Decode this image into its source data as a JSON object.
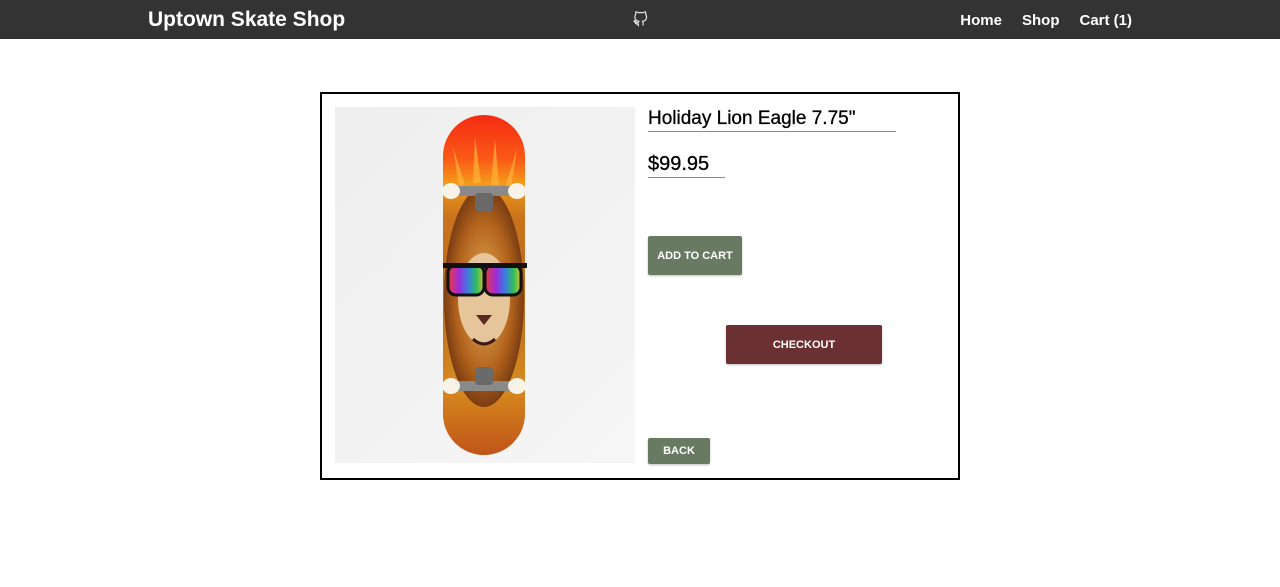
{
  "navbar": {
    "brand": "Uptown Skate Shop",
    "github_icon": "github-icon",
    "links": [
      {
        "label": "Home"
      },
      {
        "label": "Shop"
      },
      {
        "label": "Cart (1)"
      }
    ]
  },
  "product": {
    "title": "Holiday Lion Eagle 7.75\"",
    "price": "$99.95",
    "image_icon": "skateboard-lion-image"
  },
  "buttons": {
    "add_to_cart": "ADD TO CART",
    "checkout": "CHECKOUT",
    "back": "BACK"
  },
  "colors": {
    "navbar_bg": "#333333",
    "add_button": "#697a62",
    "checkout_button": "#6b3031",
    "back_button": "#697a62"
  }
}
